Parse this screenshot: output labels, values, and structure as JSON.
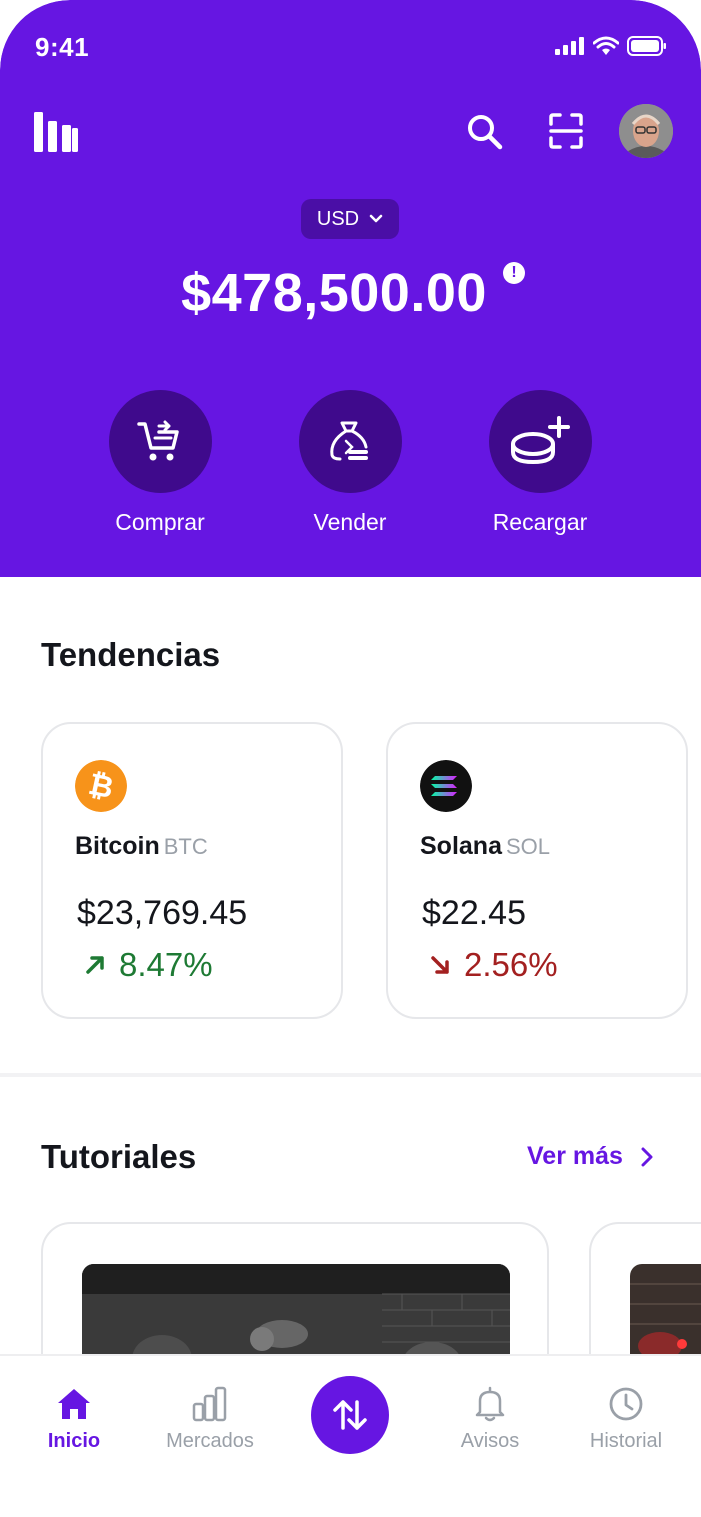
{
  "status_bar": {
    "time": "9:41"
  },
  "header": {
    "currency": "USD",
    "balance": "$478,500.00",
    "info_glyph": "!"
  },
  "actions": [
    {
      "label": "Comprar",
      "icon": "cart-icon"
    },
    {
      "label": "Vender",
      "icon": "money-bag-icon"
    },
    {
      "label": "Recargar",
      "icon": "coin-plus-icon"
    }
  ],
  "trends": {
    "title": "Tendencias",
    "items": [
      {
        "name": "Bitcoin",
        "symbol": "BTC",
        "price": "$23,769.45",
        "change": "8.47%",
        "direction": "up",
        "color": "#1E7A34",
        "icon_color": "#F7931A"
      },
      {
        "name": "Solana",
        "symbol": "SOL",
        "price": "$22.45",
        "change": "2.56%",
        "direction": "down",
        "color": "#A32020",
        "icon_color": "#111111"
      }
    ]
  },
  "tutorials": {
    "title": "Tutoriales",
    "see_more": "Ver más"
  },
  "tabbar": {
    "items": [
      {
        "label": "Inicio",
        "icon": "home-icon",
        "active": true
      },
      {
        "label": "Mercados",
        "icon": "bar-chart-icon",
        "active": false
      },
      {
        "label": "",
        "icon": "swap-icon",
        "active": false
      },
      {
        "label": "Avisos",
        "icon": "bell-icon",
        "active": false
      },
      {
        "label": "Historial",
        "icon": "clock-icon",
        "active": false
      }
    ]
  },
  "colors": {
    "brand": "#6616E2",
    "brand_dark": "#3F0A8C",
    "text": "#14161c",
    "muted": "#9aa0a8"
  }
}
